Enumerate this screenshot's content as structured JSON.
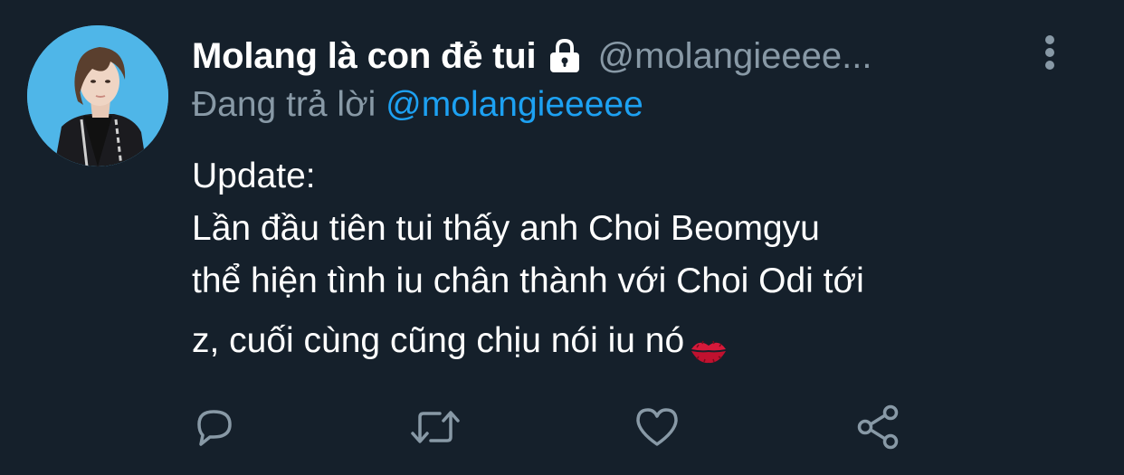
{
  "tweet": {
    "display_name": "Molang là con đẻ tui",
    "handle": "@molangieeee...",
    "reply_prefix": "Đang trả lời",
    "reply_to": "@molangieeeee",
    "body_lines": [
      "Update:",
      "Lần đầu tiên tui thấy anh Choi Beomgyu",
      "thể hiện tình iu chân thành với Choi Odi tới",
      "z, cuối cùng cũng chịu nói iu nó"
    ],
    "emoji": "kiss-mark-emoji",
    "protected_icon": "lock-icon"
  },
  "actions": {
    "reply_icon": "reply-icon",
    "retweet_icon": "retweet-icon",
    "like_icon": "heart-icon",
    "share_icon": "share-icon"
  },
  "colors": {
    "background": "#15202b",
    "primary_text": "#ffffff",
    "secondary_text": "#8899a6",
    "link": "#1da1f2",
    "icon": "#8899a6"
  }
}
